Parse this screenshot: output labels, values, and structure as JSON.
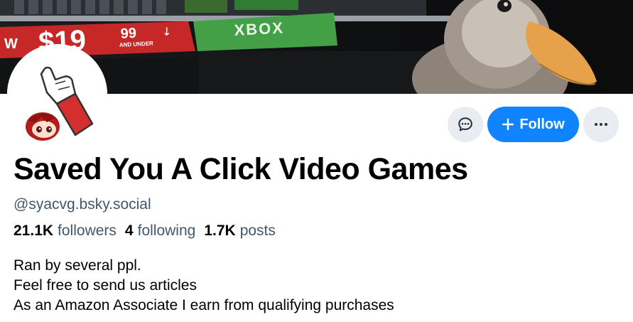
{
  "banner": {
    "price_text": "$19",
    "cents_text": "99",
    "under_text": "AND UNDER",
    "left_fragment": "W",
    "platform_text": "XBOX"
  },
  "profile": {
    "display_name": "Saved You A Click Video Games",
    "handle": "@syacvg.bsky.social"
  },
  "actions": {
    "follow_label": "Follow"
  },
  "stats": {
    "followers_count": "21.1K",
    "followers_label": "followers",
    "following_count": "4",
    "following_label": "following",
    "posts_count": "1.7K",
    "posts_label": "posts"
  },
  "bio": {
    "lines": [
      "Ran by several ppl.",
      "Feel free to send us articles",
      "As an Amazon Associate I earn from qualifying purchases"
    ]
  },
  "colors": {
    "accent": "#1083fe",
    "muted_text": "#42576c",
    "button_bg": "#e9edf1"
  }
}
